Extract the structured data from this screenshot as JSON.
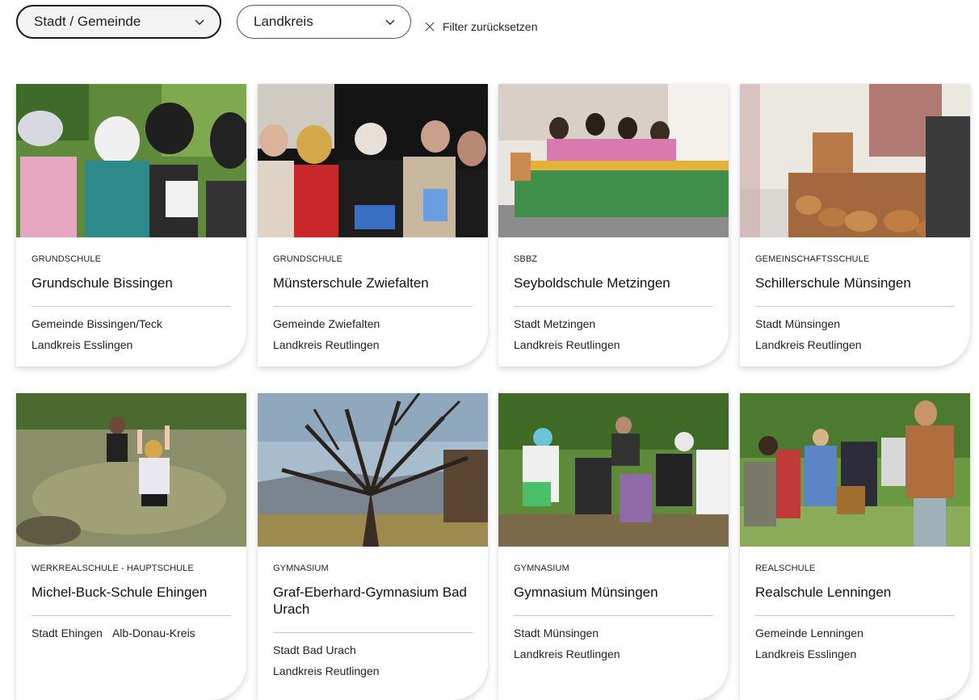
{
  "filters": {
    "city": "Stadt / Gemeinde",
    "district": "Landkreis",
    "reset": "Filter zurücksetzen"
  },
  "cards": [
    {
      "type": "Grundschule",
      "name": "Grundschule Bissingen",
      "municipality": "Gemeinde Bissingen/Teck",
      "district": "Landkreis Esslingen"
    },
    {
      "type": "Grundschule",
      "name": "Münsterschule Zwiefalten",
      "municipality": "Gemeinde Zwiefalten",
      "district": "Landkreis Reutlingen"
    },
    {
      "type": "SBBZ",
      "name": "Seyboldschule Metzingen",
      "municipality": "Stadt Metzingen",
      "district": "Landkreis Reutlingen"
    },
    {
      "type": "Gemeinschaftsschule",
      "name": "Schillerschule Münsingen",
      "municipality": "Stadt Münsingen",
      "district": "Landkreis Reutlingen"
    },
    {
      "type": "Werkrealschule - Hauptschule",
      "name": "Michel-Buck-Schule Ehingen",
      "municipality": "Stadt Ehingen",
      "district": "Alb-Donau-Kreis"
    },
    {
      "type": "Gymnasium",
      "name": "Graf-Eberhard-Gymnasium Bad Urach",
      "municipality": "Stadt Bad Urach",
      "district": "Landkreis Reutlingen"
    },
    {
      "type": "Gymnasium",
      "name": "Gymnasium Münsingen",
      "municipality": "Stadt Münsingen",
      "district": "Landkreis Reutlingen"
    },
    {
      "type": "Realschule",
      "name": "Realschule Lenningen",
      "municipality": "Gemeinde Lenningen",
      "district": "Landkreis Esslingen"
    }
  ],
  "icons": {
    "dropdown": "chevron-down-icon",
    "reset": "close-icon"
  },
  "colors": {
    "text": "#1a1a1a",
    "divider": "#c8c8c8"
  }
}
